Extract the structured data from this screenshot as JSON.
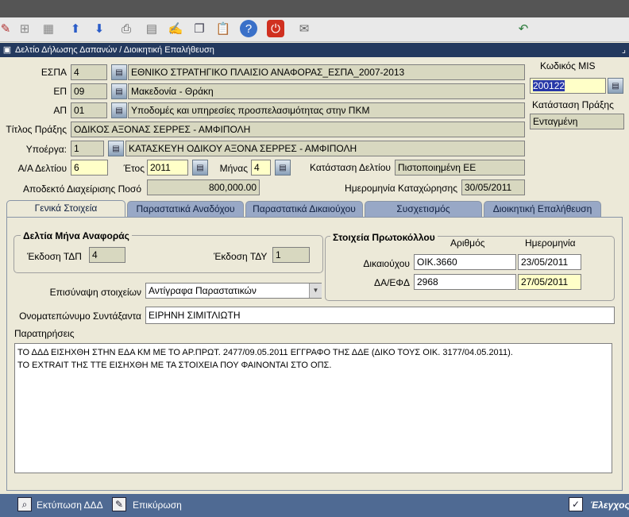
{
  "toolbar": {
    "icons": [
      "edit-icon",
      "new-record-icon",
      "grid-icon",
      "arrow-up-icon",
      "arrow-down-icon",
      "print-icon",
      "print-preview-icon",
      "edit-form-icon",
      "copy-icon",
      "paste-icon",
      "help-icon",
      "exit-icon",
      "notes-icon",
      "back-icon"
    ]
  },
  "window": {
    "title": "Δελτίο Δήλωσης Δαπανών / Διοικητική Επαλήθευση",
    "minimize": "⌟"
  },
  "header": {
    "espa_label": "ΕΣΠΑ",
    "espa_code": "4",
    "espa_desc": "ΕΘΝΙΚΟ ΣΤΡΑΤΗΓΙΚΟ ΠΛΑΙΣΙΟ ΑΝΑΦΟΡΑΣ_ΕΣΠΑ_2007-2013",
    "ep_label": "ΕΠ",
    "ep_code": "09",
    "ep_desc": "Μακεδονία - Θράκη",
    "ap_label": "ΑΠ",
    "ap_code": "01",
    "ap_desc": "Υποδομές και υπηρεσίες προσπελασιμότητας στην ΠΚΜ",
    "title_label": "Τίτλος Πράξης",
    "title_value": "ΟΔΙΚΟΣ ΑΞΟΝΑΣ ΣΕΡΡΕΣ - ΑΜΦΙΠΟΛΗ",
    "subproject_label": "Υποέργα:",
    "subproject_code": "1",
    "subproject_desc": "ΚΑΤΑΣΚΕΥΗ ΟΔΙΚΟΥ ΑΞΟΝΑ ΣΕΡΡΕΣ - ΑΜΦΙΠΟΛΗ",
    "aa_label": "Α/Α Δελτίου",
    "aa_value": "6",
    "year_label": "Έτος",
    "year_value": "2011",
    "month_label": "Μήνας",
    "month_value": "4",
    "status_label": "Κατάσταση Δελτίου",
    "status_value": "Πιστοποιημένη ΕΕ",
    "amount_label": "Αποδεκτό Διαχείρισης Ποσό",
    "amount_value": "800,000.00",
    "date_label": "Ημερομηνία Καταχώρησης",
    "date_value": "30/05/2011",
    "mis_label": "Κωδικός MIS",
    "mis_value": "200122",
    "praxis_status_label": "Κατάσταση Πράξης",
    "praxis_status_value": "Ενταγμένη"
  },
  "tabs": [
    {
      "label": "Γενικά Στοιχεία"
    },
    {
      "label": "Παραστατικά Αναδόχου"
    },
    {
      "label": "Παραστατικά Δικαιούχου"
    },
    {
      "label": "Συσχετισμός"
    },
    {
      "label": "Διοικητική Επαλήθευση"
    }
  ],
  "general": {
    "monthly_group_title": "Δελτία Μήνα Αναφοράς",
    "tdp_label": "Έκδοση ΤΔΠ",
    "tdp_value": "4",
    "tdy_label": "Έκδοση ΤΔΥ",
    "tdy_value": "1",
    "protocol_group_title": "Στοιχεία Πρωτοκόλλου",
    "col_number": "Αριθμός",
    "col_date": "Ημερομηνία",
    "beneficiary_label": "Δικαιούχου",
    "beneficiary_number": "ΟΙΚ.3660",
    "beneficiary_date": "23/05/2011",
    "daefd_label": "ΔΑ/ΕΦΔ",
    "daefd_number": "2968",
    "daefd_date": "27/05/2011",
    "attach_label": "Επισύναψη στοιχείων",
    "attach_value": "Αντίγραφα Παραστατικών",
    "author_label": "Ονοματεπώνυμο Συντάξαντα",
    "author_value": "ΕΙΡΗΝΗ ΣΙΜΙΤΛΙΩΤΗ",
    "remarks_label": "Παρατηρήσεις",
    "remarks_line1": "ΤΟ ΔΔΔ ΕΙΣΗΧΘΗ ΣΤΗΝ ΕΔΑ ΚΜ ΜΕ ΤΟ ΑΡ.ΠΡΩΤ. 2477/09.05.2011 ΕΓΓΡΑΦΟ ΤΗΣ ΔΔΕ (ΔΙΚΟ ΤΟΥΣ ΟΙΚ. 3177/04.05.2011).",
    "remarks_line2": "ΤΟ EXTRAIT ΤΗΣ ΤΤΕ ΕΙΣΗΧΘΗ ΜΕ ΤΑ ΣΤΟΙΧΕΙΑ ΠΟΥ ΦΑΙΝΟΝΤΑΙ ΣΤΟ ΟΠΣ."
  },
  "statusbar": {
    "print_label": "Εκτύπωση ΔΔΔ",
    "validate_label": "Επικύρωση",
    "check_label": "Έλεγχος"
  }
}
